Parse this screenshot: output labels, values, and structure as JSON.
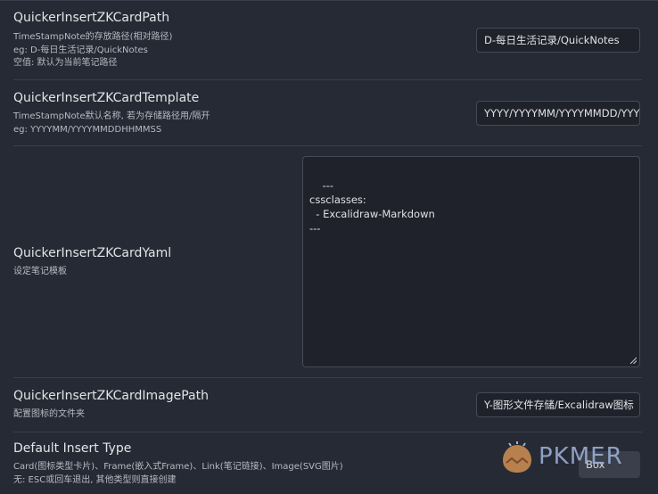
{
  "settings": [
    {
      "name": "QuickerInsertZKCardPath",
      "desc": [
        "TimeStampNote的存放路径(相对路径)",
        "eg: D-每日生活记录/QuickNotes",
        "空值: 默认为当前笔记路径"
      ],
      "value": "D-每日生活记录/QuickNotes"
    },
    {
      "name": "QuickerInsertZKCardTemplate",
      "desc": [
        "TimeStampNote默认名称, 若为存储路径用/隔开",
        "eg: YYYYMM/YYYYMMDDHHMMSS"
      ],
      "value": "YYYY/YYYYMM/YYYYMMDD/YYYYMMDDHHMMSS"
    },
    {
      "name": "QuickerInsertZKCardYaml",
      "desc": [
        "设定笔记模板"
      ],
      "value": "---\ncssclasses:\n  - Excalidraw-Markdown\n---"
    },
    {
      "name": "QuickerInsertZKCardImagePath",
      "desc": [
        "配置图标的文件夹"
      ],
      "value": "Y-图形文件存储/Excalidraw图标"
    },
    {
      "name": "Default Insert Type",
      "desc": [
        "Card(图标类型卡片)、Frame(嵌入式Frame)、Link(笔记链接)、Image(SVG图片)",
        "无: ESC或回车退出, 其他类型则直接创建"
      ],
      "value": "Box"
    }
  ],
  "watermark": {
    "text": "PKMER"
  },
  "icons": {
    "resize": "resize-grip-icon",
    "logo": "pkmer-logo-icon"
  }
}
